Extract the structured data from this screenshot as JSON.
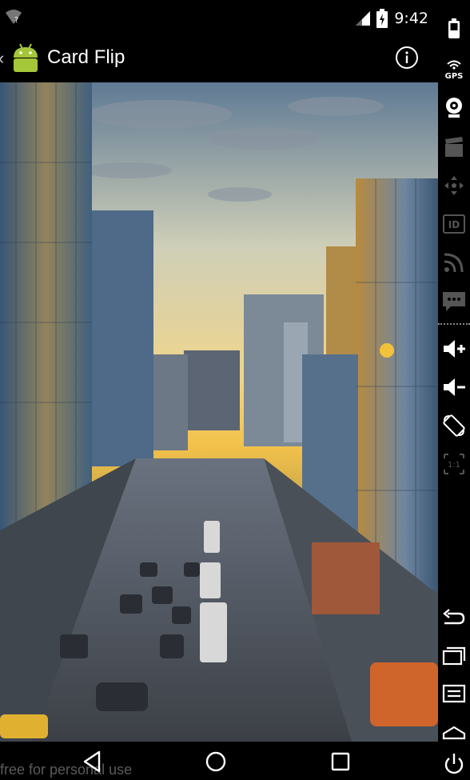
{
  "status_bar": {
    "time": "9:42",
    "wifi_badge": "?"
  },
  "action_bar": {
    "title": "Card Flip",
    "up_glyph": "‹"
  },
  "content": {
    "image_alt": "city street scene"
  },
  "watermark": "free for personal use",
  "colors": {
    "background": "#000000",
    "android_green": "#a4c639"
  },
  "icons": {
    "status": [
      "wifi-question-icon",
      "cell-signal-icon",
      "battery-charging-icon"
    ],
    "nav": [
      "back-icon",
      "home-icon",
      "recents-icon"
    ],
    "toolbar": [
      "battery-icon",
      "gps-icon",
      "camera-icon",
      "video-icon",
      "dpad-icon",
      "id-icon",
      "rss-icon",
      "sms-icon",
      "volume-up-icon",
      "volume-down-icon",
      "rotate-icon",
      "scale-icon",
      "back-icon",
      "recents-icon",
      "menu-icon",
      "home-icon",
      "power-icon"
    ]
  },
  "toolbar_labels": {
    "gps": "GPS",
    "id": "ID",
    "scale": "1:1"
  }
}
